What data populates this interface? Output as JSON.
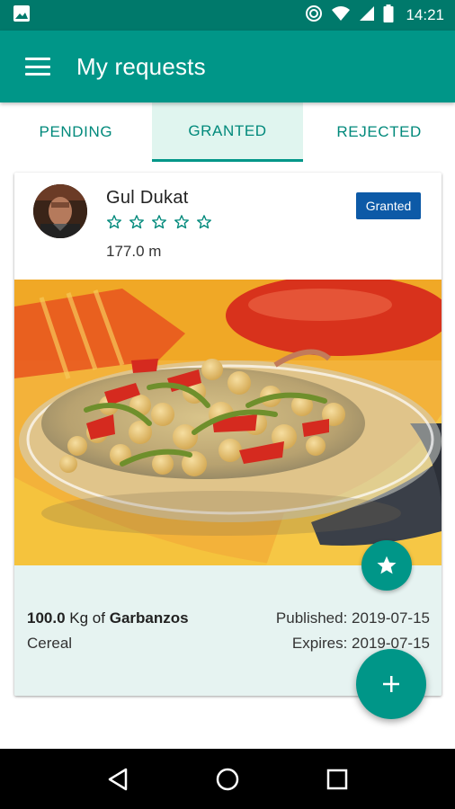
{
  "status_bar": {
    "time": "14:21",
    "icons": [
      "image-icon",
      "do-not-disturb-icon",
      "wifi-icon",
      "signal-icon",
      "battery-icon"
    ]
  },
  "app_bar": {
    "title": "My requests",
    "menu_icon": "menu-icon"
  },
  "tabs": [
    {
      "label": "PENDING",
      "active": false
    },
    {
      "label": "GRANTED",
      "active": true
    },
    {
      "label": "REJECTED",
      "active": false
    }
  ],
  "card": {
    "user": {
      "name": "Gul Dukat",
      "rating": 0,
      "rating_max": 5,
      "distance": "177.0 m"
    },
    "status": "Granted",
    "status_color": "#0d5aa7",
    "image_subject": "chickpea salad in glass bowl",
    "food": {
      "quantity": "100.0",
      "unit": "Kg of",
      "name": "Garbanzos",
      "category": "Cereal",
      "published": "Published: 2019-07-15",
      "expires": "Expires: 2019-07-15"
    }
  },
  "fab": {
    "favorite_icon": "star-icon",
    "add_icon": "plus-icon"
  },
  "nav_bar": {
    "icons": [
      "back-icon",
      "home-icon",
      "recents-icon"
    ]
  },
  "colors": {
    "primary": "#009688",
    "primary_dark": "#00796b",
    "tab_active_bg": "#e0f5ef",
    "info_bg": "#e6f3f1"
  }
}
